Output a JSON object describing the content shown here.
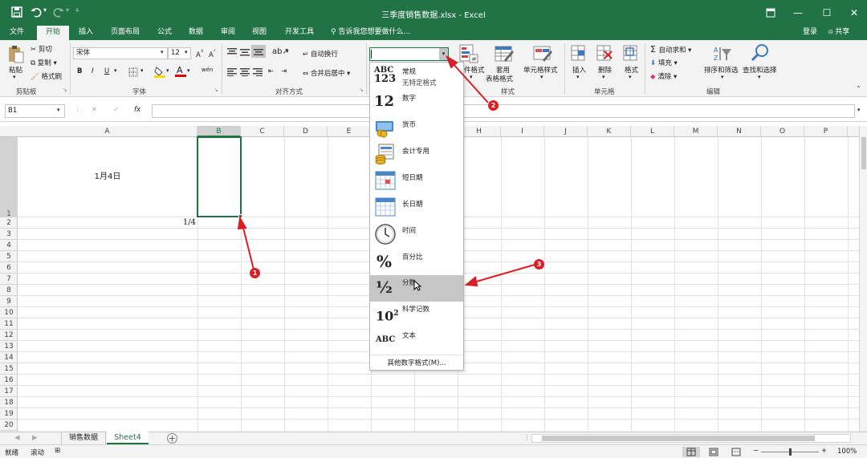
{
  "window": {
    "title": "三季度销售数据.xlsx  -  Excel"
  },
  "tabs": [
    "文件",
    "开始",
    "插入",
    "页面布局",
    "公式",
    "数据",
    "审阅",
    "视图",
    "开发工具"
  ],
  "tell_me": "告诉我您想要做什么...",
  "account": {
    "login": "登录",
    "share": "共享"
  },
  "ribbon": {
    "clipboard": {
      "paste": "粘贴",
      "cut": "剪切",
      "copy": "复制",
      "format_painter": "格式刷",
      "label": "剪贴板"
    },
    "font": {
      "name": "宋体",
      "size": "12",
      "label": "字体",
      "bold": "B",
      "italic": "I",
      "underline": "U",
      "phonetic": "wén"
    },
    "alignment": {
      "wrap": "自动换行",
      "merge": "合并后居中",
      "label": "对齐方式"
    },
    "number": {
      "format_value": "",
      "label": "数字"
    },
    "styles": {
      "conditional": "条件格式",
      "table": "套用\n表格格式",
      "table_l1": "套用",
      "table_l2": "表格格式",
      "cell": "单元格样式",
      "label": "样式"
    },
    "cells": {
      "insert": "插入",
      "delete": "删除",
      "format": "格式",
      "label": "单元格"
    },
    "editing": {
      "autosum": "自动求和",
      "fill": "填充",
      "clear": "清除",
      "sort": "排序和筛选",
      "find": "查找和选择",
      "label": "编辑"
    }
  },
  "formula_bar": {
    "name_box": "B1",
    "cancel": "✕",
    "enter": "✓",
    "fx": "fx",
    "content": ""
  },
  "columns": [
    "A",
    "B",
    "C",
    "D",
    "E",
    "F",
    "G",
    "H",
    "I",
    "J",
    "K",
    "L",
    "M",
    "N",
    "O",
    "P"
  ],
  "rows": [
    "1",
    "2",
    "3",
    "4",
    "5",
    "6",
    "7",
    "8",
    "9",
    "10",
    "11",
    "12",
    "13",
    "14",
    "15",
    "16",
    "17",
    "18",
    "19",
    "20"
  ],
  "cells": {
    "A1": "1月4日",
    "A2": "1/4"
  },
  "number_format_menu": {
    "items": [
      {
        "label": "常规",
        "sub": "无特定格式",
        "icon": "abc-123-icon",
        "glyph": "ABC\n123"
      },
      {
        "label": "数字",
        "icon": "number-12-icon",
        "glyph": "12"
      },
      {
        "label": "货币",
        "icon": "currency-icon"
      },
      {
        "label": "会计专用",
        "icon": "accounting-icon"
      },
      {
        "label": "短日期",
        "icon": "short-date-icon"
      },
      {
        "label": "长日期",
        "icon": "long-date-icon"
      },
      {
        "label": "时间",
        "icon": "clock-icon"
      },
      {
        "label": "百分比",
        "icon": "percent-icon",
        "glyph": "%"
      },
      {
        "label": "分数",
        "icon": "fraction-icon",
        "glyph": "½"
      },
      {
        "label": "科学记数",
        "icon": "scientific-icon",
        "glyph": "10²"
      },
      {
        "label": "文本",
        "icon": "text-abc-icon",
        "glyph": "ABC"
      }
    ],
    "more": "其他数字格式(M)...",
    "highlighted": "分数"
  },
  "sheets": [
    "销售数据",
    "Sheet4"
  ],
  "active_sheet": "Sheet4",
  "status": {
    "ready": "就绪",
    "scroll": "滚动",
    "zoom": "100%"
  },
  "annotations": [
    "1",
    "2",
    "3"
  ],
  "colors": {
    "excel_green": "#217346",
    "annotation_red": "#d81f26",
    "highlight": "#c6c6c6"
  }
}
